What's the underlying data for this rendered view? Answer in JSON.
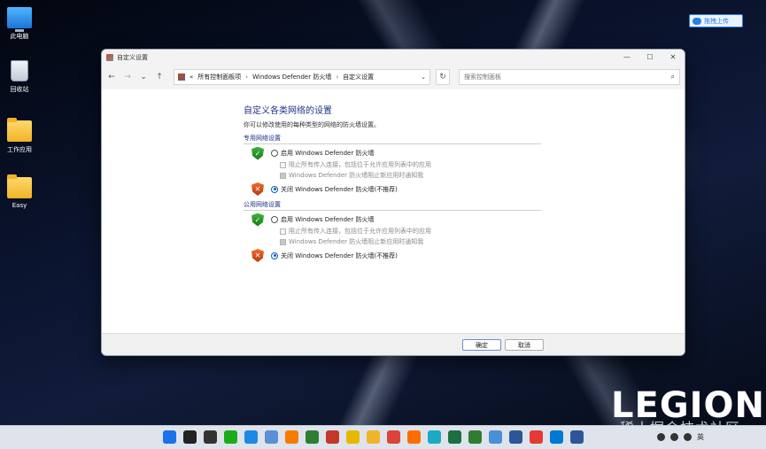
{
  "desktop": {
    "icons": [
      {
        "label": "此电脑",
        "icon": "computer-icon"
      },
      {
        "label": "回收站",
        "icon": "recycle-bin-icon"
      },
      {
        "label": "工作应用",
        "icon": "folder-icon"
      },
      {
        "label": "Easy",
        "icon": "folder-icon"
      }
    ],
    "upload_badge": "拖拽上传",
    "brand_text": "LEGION",
    "watermark": "稀土掘金技术社区"
  },
  "window": {
    "title": "自定义设置",
    "controls": {
      "minimize": "—",
      "maximize": "☐",
      "close": "✕"
    },
    "nav": {
      "back": "←",
      "forward": "→",
      "history": "⌄",
      "up": "↑"
    },
    "breadcrumb": {
      "overflow": "«",
      "items": [
        "所有控制面板项",
        "Windows Defender 防火墙",
        "自定义设置"
      ],
      "separator": "›",
      "dropdown": "⌄"
    },
    "refresh": "↻",
    "search": {
      "placeholder": "搜索控制面板",
      "value": ""
    },
    "page_title": "自定义各类网络的设置",
    "page_desc": "你可以修改使用的每种类型的网络的防火墙设置。",
    "sections": [
      {
        "heading": "专用网络设置",
        "enable_label": "启用 Windows Defender 防火墙",
        "block_label": "阻止所有传入连接，包括位于允许应用列表中的应用",
        "notify_label": "Windows Defender 防火墙阻止新应用时通知我",
        "disable_label": "关闭 Windows Defender 防火墙(不推荐)",
        "selected": "disable",
        "block_checked": false,
        "notify_checked": true
      },
      {
        "heading": "公用网络设置",
        "enable_label": "启用 Windows Defender 防火墙",
        "block_label": "阻止所有传入连接，包括位于允许应用列表中的应用",
        "notify_label": "Windows Defender 防火墙阻止新应用时通知我",
        "disable_label": "关闭 Windows Defender 防火墙(不推荐)",
        "selected": "disable",
        "block_checked": false,
        "notify_checked": true
      }
    ],
    "buttons": {
      "ok": "确定",
      "cancel": "取消"
    }
  },
  "taskbar": {
    "apps": [
      "start-icon",
      "search-icon",
      "task-view-icon",
      "wechat-icon",
      "browser-icon",
      "photos-icon",
      "vlc-icon",
      "app-icon",
      "app-icon",
      "app-icon",
      "file-explorer-icon",
      "chrome-icon",
      "firefox-icon",
      "edge-icon",
      "excel-icon",
      "app-icon",
      "app-icon",
      "app-icon",
      "app-icon",
      "edge-icon",
      "word-icon"
    ],
    "app_colors": [
      "#1a73e8",
      "#222222",
      "#333333",
      "#1aad19",
      "#1e88e5",
      "#5b8fd6",
      "#f57c00",
      "#2e7d32",
      "#c0392b",
      "#e6b800",
      "#f0b429",
      "#db4437",
      "#ff6d00",
      "#1ba9c4",
      "#1d6f42",
      "#2e7d32",
      "#4a90d9",
      "#2b5797",
      "#e53935",
      "#0078d4",
      "#2b579a"
    ],
    "tray": {
      "ime": "英"
    }
  }
}
